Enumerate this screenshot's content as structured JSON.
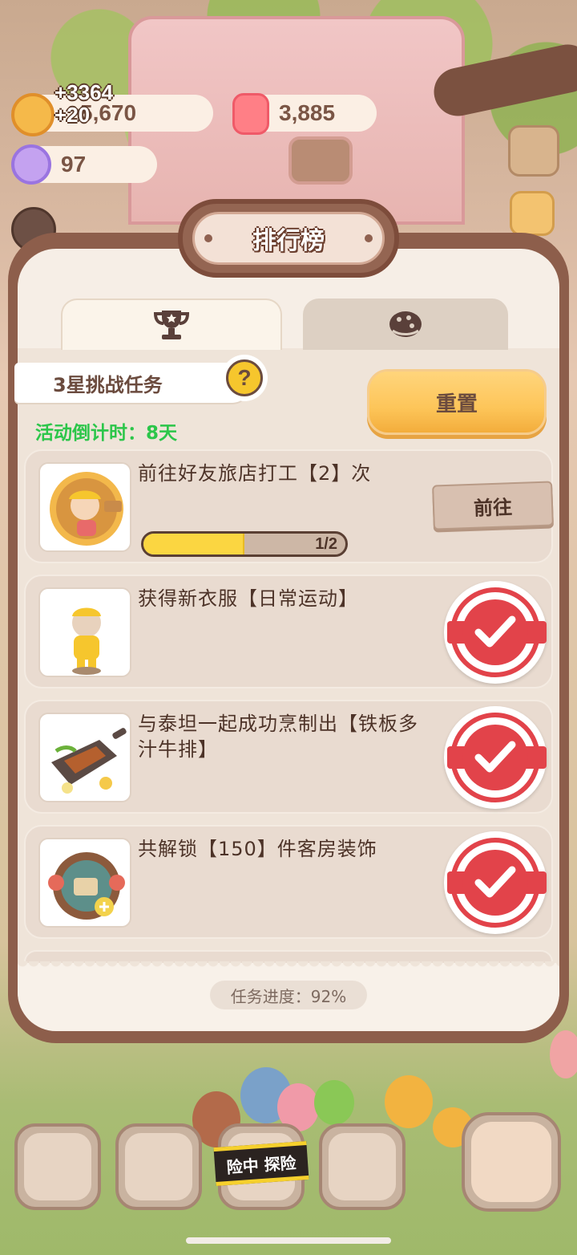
{
  "resources": {
    "coins_value": "5,670",
    "coins_popup_1": "+3364",
    "coins_popup_2": "+20",
    "gems_value": "3,885",
    "candy_value": "97"
  },
  "dialog": {
    "title": "排行榜",
    "tabs": [
      {
        "icon": "trophy-icon",
        "active": true
      },
      {
        "icon": "cookie-icon",
        "active": false
      }
    ],
    "challenge_label": "3星挑战任务",
    "help_symbol": "?",
    "countdown": "活动倒计时：8天",
    "reset_label": "重置",
    "tasks": [
      {
        "title": "前往好友旅店打工【2】次",
        "progress_text": "1/2",
        "progress": 0.5,
        "action_label": "前往",
        "completed": false,
        "thumb": "worker-character-icon"
      },
      {
        "title": "获得新衣服【日常运动】",
        "completed": true,
        "thumb": "outfit-character-icon"
      },
      {
        "title": "与泰坦一起成功烹制出【铁板多汁牛排】",
        "completed": true,
        "thumb": "steak-dish-icon"
      },
      {
        "title": "共解锁【150】件客房装饰",
        "completed": true,
        "thumb": "decoration-badge-icon"
      }
    ],
    "overall_progress": "任务进度：92%"
  },
  "bottom_nav": {
    "explore_text": "险中 探险"
  },
  "colors": {
    "accent_green": "#2cc64a",
    "stamp_red": "#e2434a",
    "button_yellow": "#fdc559"
  }
}
